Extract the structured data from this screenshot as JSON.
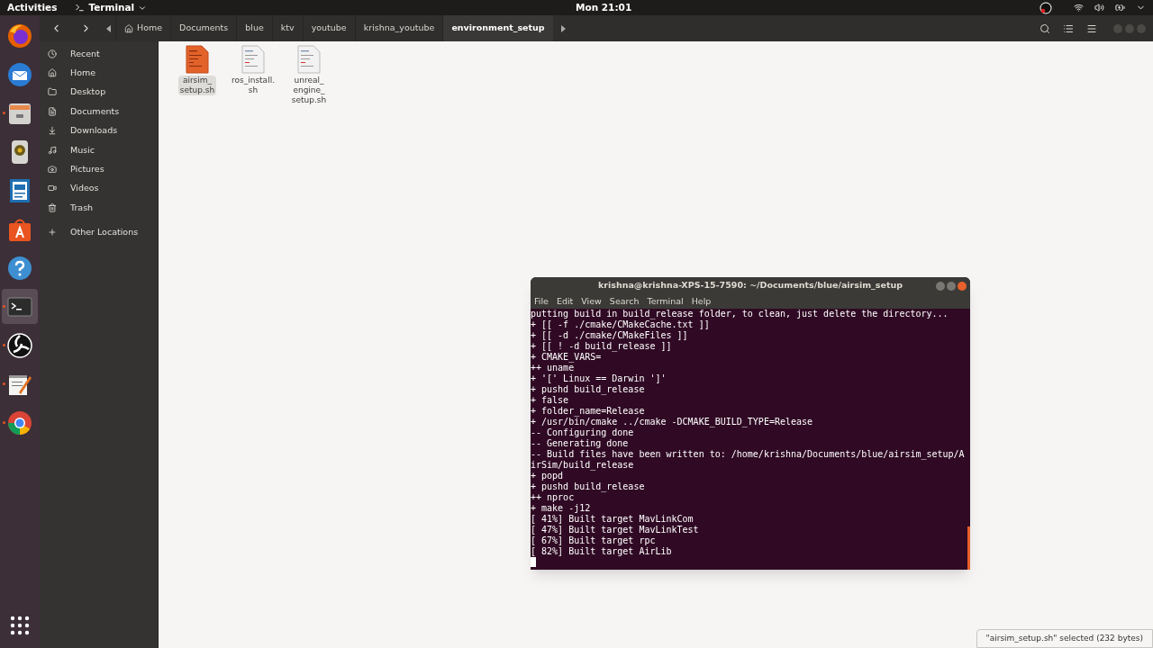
{
  "top_bar": {
    "activities": "Activities",
    "app_menu": "Terminal",
    "clock": "Mon 21:01"
  },
  "dock": [
    {
      "kind": "firefox",
      "running": false,
      "selected": false
    },
    {
      "kind": "mail",
      "running": false,
      "selected": false
    },
    {
      "kind": "files",
      "running": true,
      "selected": false
    },
    {
      "kind": "speaker",
      "running": false,
      "selected": false
    },
    {
      "kind": "writer",
      "running": false,
      "selected": false
    },
    {
      "kind": "store",
      "running": false,
      "selected": false
    },
    {
      "kind": "help",
      "running": false,
      "selected": false
    },
    {
      "kind": "terminal",
      "running": true,
      "selected": true
    },
    {
      "kind": "obs",
      "running": true,
      "selected": false
    },
    {
      "kind": "editor",
      "running": true,
      "selected": false
    },
    {
      "kind": "chrome",
      "running": true,
      "selected": false
    },
    {
      "kind": "grid",
      "running": false,
      "selected": false
    }
  ],
  "path_bar": [
    {
      "label": "Home",
      "home": true,
      "selected": false
    },
    {
      "label": "Documents",
      "home": false,
      "selected": false
    },
    {
      "label": "blue",
      "home": false,
      "selected": false
    },
    {
      "label": "ktv",
      "home": false,
      "selected": false
    },
    {
      "label": "youtube",
      "home": false,
      "selected": false
    },
    {
      "label": "krishna_youtube",
      "home": false,
      "selected": false
    },
    {
      "label": "environment_setup",
      "home": false,
      "selected": true
    }
  ],
  "sidebar": [
    {
      "label": "Recent",
      "kind": "recent"
    },
    {
      "label": "Home",
      "kind": "home"
    },
    {
      "label": "Desktop",
      "kind": "desktop"
    },
    {
      "label": "Documents",
      "kind": "documents"
    },
    {
      "label": "Downloads",
      "kind": "downloads"
    },
    {
      "label": "Music",
      "kind": "music"
    },
    {
      "label": "Pictures",
      "kind": "pictures"
    },
    {
      "label": "Videos",
      "kind": "videos"
    },
    {
      "label": "Trash",
      "kind": "trash"
    },
    {
      "label": "Other Locations",
      "kind": "add"
    }
  ],
  "files": [
    {
      "name_lines": [
        "airsim_",
        "setup.sh"
      ],
      "selected": true
    },
    {
      "name_lines": [
        "ros_install.",
        "sh"
      ],
      "selected": false
    },
    {
      "name_lines": [
        "unreal_",
        "engine_",
        "setup.sh"
      ],
      "selected": false
    }
  ],
  "terminal": {
    "title": "krishna@krishna-XPS-15-7590: ~/Documents/blue/airsim_setup",
    "menu": [
      "File",
      "Edit",
      "View",
      "Search",
      "Terminal",
      "Help"
    ],
    "lines": [
      "putting build in build_release folder, to clean, just delete the directory...",
      "+ [[ -f ./cmake/CMakeCache.txt ]]",
      "+ [[ -d ./cmake/CMakeFiles ]]",
      "+ [[ ! -d build_release ]]",
      "+ CMAKE_VARS=",
      "++ uname",
      "+ '[' Linux == Darwin ']'",
      "+ pushd build_release",
      "+ false",
      "+ folder_name=Release",
      "+ /usr/bin/cmake ../cmake -DCMAKE_BUILD_TYPE=Release",
      "-- Configuring done",
      "-- Generating done",
      "-- Build files have been written to: /home/krishna/Documents/blue/airsim_setup/A",
      "irSim/build_release",
      "+ popd",
      "+ pushd build_release",
      "++ nproc",
      "+ make -j12",
      "[ 41%] Built target MavLinkCom",
      "[ 47%] Built target MavLinkTest",
      "[ 67%] Built target rpc",
      "[ 82%] Built target AirLib"
    ],
    "cursor": true
  },
  "status": "\"airsim_setup.sh\" selected (232 bytes)"
}
